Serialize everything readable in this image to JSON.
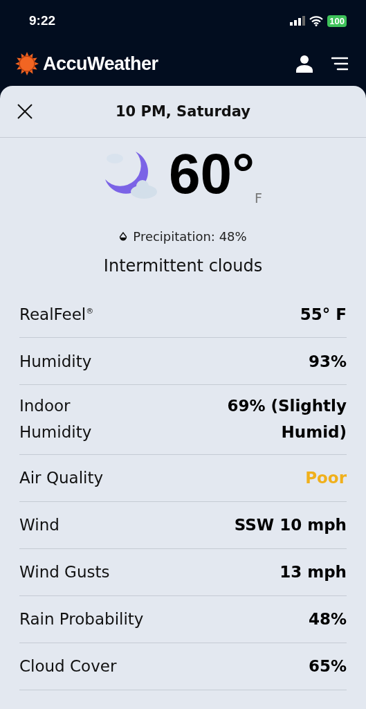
{
  "status_bar": {
    "time": "9:22",
    "battery": "100"
  },
  "header": {
    "brand": "AccuWeather"
  },
  "sheet": {
    "title": "10 PM, Saturday",
    "temperature": "60°",
    "unit": "F",
    "precipitation": "Precipitation: 48%",
    "condition": "Intermittent clouds"
  },
  "details": [
    {
      "label": "RealFeel$^{®}$",
      "value": "55° F",
      "color": "#000000"
    },
    {
      "label": "Humidity",
      "value": "93%",
      "color": "#000000"
    },
    {
      "label": "Indoor Humidity",
      "value": "69% (Slightly Humid)",
      "color": "#000000"
    },
    {
      "label": "Air Quality",
      "value": "Poor",
      "color": "#f0b01c"
    },
    {
      "label": "Wind",
      "value": "SSW 10 mph",
      "color": "#000000"
    },
    {
      "label": "Wind Gusts",
      "value": "13 mph",
      "color": "#000000"
    },
    {
      "label": "Rain Probability",
      "value": "48%",
      "color": "#000000"
    },
    {
      "label": "Cloud Cover",
      "value": "65%",
      "color": "#000000"
    }
  ]
}
